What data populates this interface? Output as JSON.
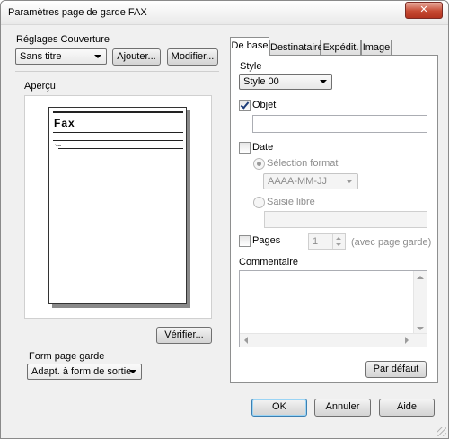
{
  "window": {
    "title": "Paramètres page de garde FAX",
    "close_label": "✕"
  },
  "cover": {
    "label": "Réglages Couverture",
    "selected": "Sans titre",
    "add_label": "Ajouter...",
    "modify_label": "Modifier..."
  },
  "preview": {
    "label": "Aperçu",
    "page_heading": "Fax",
    "line_small_text": "Yaa",
    "check_label": "Vérifier..."
  },
  "form": {
    "label": "Form page garde",
    "selected": "Adapt. à form de sortie"
  },
  "tabs": [
    {
      "label": "De base",
      "active": true
    },
    {
      "label": "Destinataire",
      "active": false
    },
    {
      "label": "Expédit.",
      "active": false
    },
    {
      "label": "Image",
      "active": false
    }
  ],
  "basic": {
    "style_label": "Style",
    "style_selected": "Style 00",
    "subject_label": "Objet",
    "subject_checked": true,
    "subject_value": "",
    "date_label": "Date",
    "date_checked": false,
    "format_select_label": "Sélection format",
    "format_selected": "AAAA-MM-JJ",
    "free_entry_label": "Saisie libre",
    "free_entry_value": "",
    "pages_label": "Pages",
    "pages_checked": false,
    "pages_value": "1",
    "pages_note": "(avec page garde)",
    "comment_label": "Commentaire",
    "comment_value": "",
    "default_label": "Par défaut"
  },
  "footer": {
    "ok_label": "OK",
    "cancel_label": "Annuler",
    "help_label": "Aide"
  }
}
